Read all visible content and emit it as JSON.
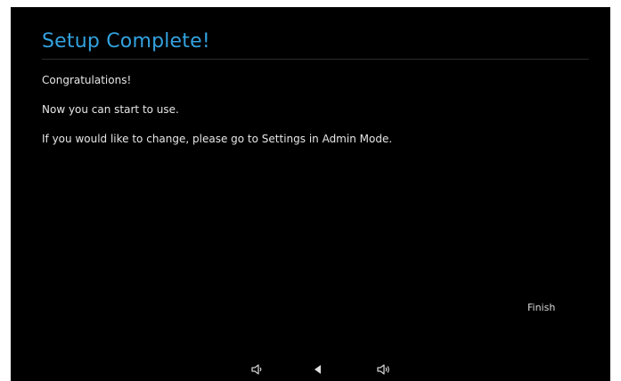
{
  "setup": {
    "title": "Setup Complete!",
    "lines": [
      "Congratulations!",
      "Now you can start to use.",
      "If you would like to change, please go to Settings in Admin Mode."
    ],
    "finish_label": "Finish"
  },
  "navbar": {
    "buttons": [
      "volume-down-icon",
      "back-icon",
      "volume-up-icon"
    ]
  },
  "colors": {
    "accent": "#33a2df",
    "background": "#000000",
    "text": "#e6e6e6"
  }
}
